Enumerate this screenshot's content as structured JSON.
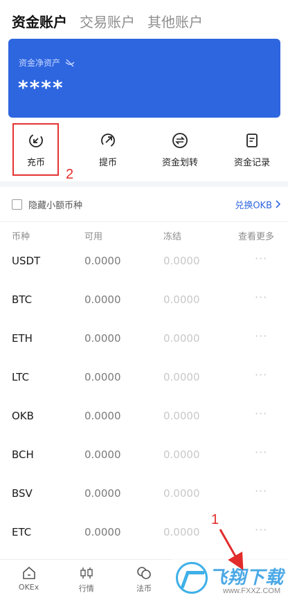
{
  "tabs": [
    {
      "label": "资金账户",
      "active": true
    },
    {
      "label": "交易账户",
      "active": false
    },
    {
      "label": "其他账户",
      "active": false
    }
  ],
  "card": {
    "label": "资金净资产",
    "value": "****",
    "color": "#2e66e0",
    "toggle_icon": "eye-off-icon"
  },
  "actions": [
    {
      "label": "充币",
      "icon": "deposit-arrow-icon"
    },
    {
      "label": "提币",
      "icon": "withdraw-arrow-icon"
    },
    {
      "label": "资金划转",
      "icon": "transfer-icon"
    },
    {
      "label": "资金记录",
      "icon": "record-icon"
    }
  ],
  "annotations": {
    "one": "1",
    "two": "2",
    "color": "#e22b2b"
  },
  "filter": {
    "hide_small_label": "隐藏小额币种",
    "hide_small_checked": false,
    "exchange_label": "兑换OKB"
  },
  "table": {
    "headers": {
      "currency": "币种",
      "available": "可用",
      "frozen": "冻结",
      "more": "查看更多"
    },
    "rows": [
      {
        "currency": "USDT",
        "available": "0.0000",
        "frozen": "0.0000",
        "more": "···"
      },
      {
        "currency": "BTC",
        "available": "0.0000",
        "frozen": "0.0000",
        "more": "···"
      },
      {
        "currency": "ETH",
        "available": "0.0000",
        "frozen": "0.0000",
        "more": "···"
      },
      {
        "currency": "LTC",
        "available": "0.0000",
        "frozen": "0.0000",
        "more": "···"
      },
      {
        "currency": "OKB",
        "available": "0.0000",
        "frozen": "0.0000",
        "more": "···"
      },
      {
        "currency": "BCH",
        "available": "0.0000",
        "frozen": "0.0000",
        "more": "···"
      },
      {
        "currency": "BSV",
        "available": "0.0000",
        "frozen": "0.0000",
        "more": "···"
      },
      {
        "currency": "ETC",
        "available": "0.0000",
        "frozen": "0.0000",
        "more": "···"
      }
    ]
  },
  "tabbar": [
    {
      "label": "OKEx",
      "icon": "home-icon"
    },
    {
      "label": "行情",
      "icon": "candlestick-icon"
    },
    {
      "label": "法币",
      "icon": "coins-icon"
    }
  ],
  "watermark": {
    "text": "飞翔下载",
    "url": "www.FXXZ.COM"
  }
}
